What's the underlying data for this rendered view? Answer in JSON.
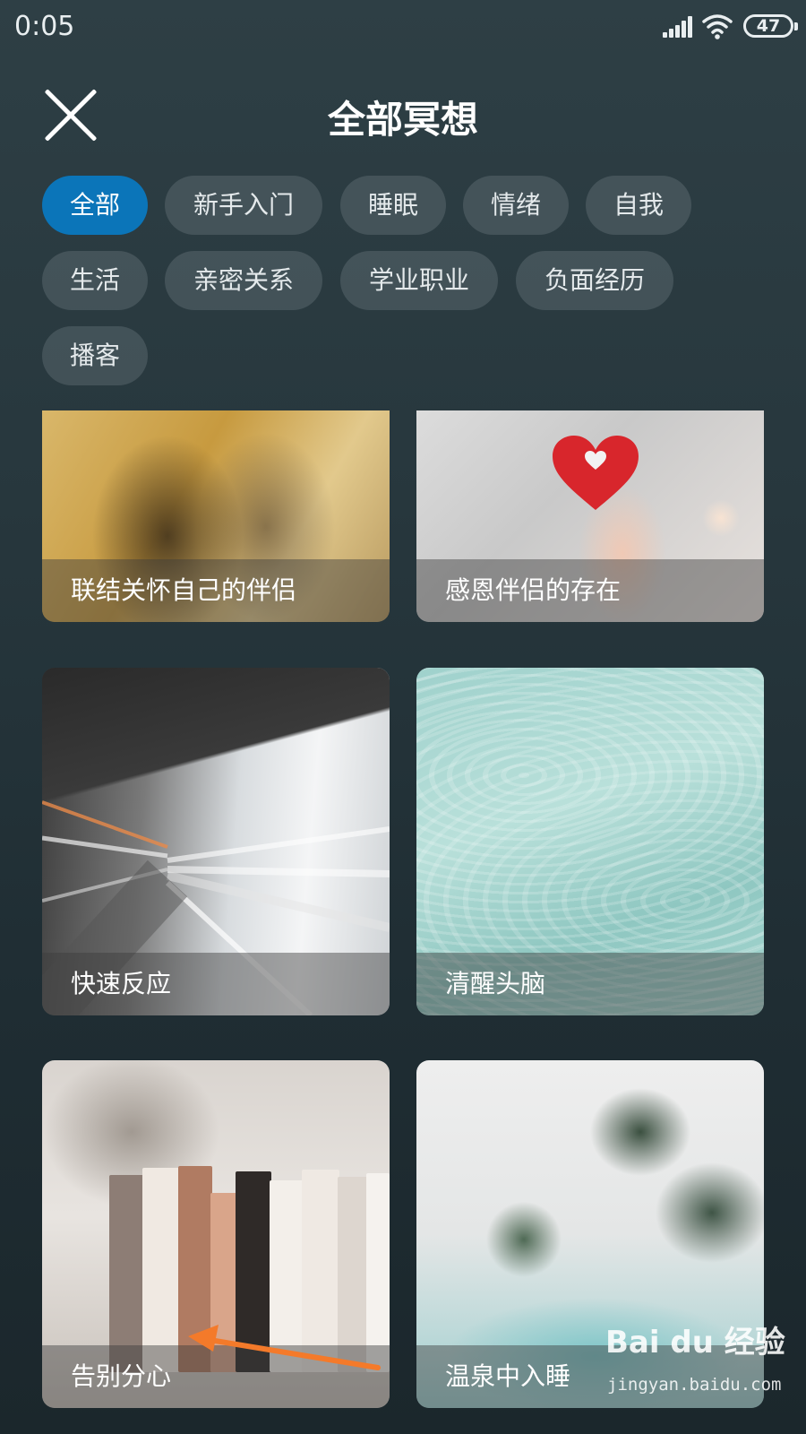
{
  "status_bar": {
    "time": "0:05",
    "battery": "47",
    "icons": [
      "signal-icon",
      "wifi-icon",
      "battery-icon"
    ]
  },
  "header": {
    "title": "全部冥想",
    "close_icon": "close-icon"
  },
  "filters": {
    "active_index": 0,
    "items": [
      "全部",
      "新手入门",
      "睡眠",
      "情绪",
      "自我",
      "生活",
      "亲密关系",
      "学业职业",
      "负面经历",
      "播客"
    ]
  },
  "cards": [
    {
      "title": "联结关怀自己的伴侣"
    },
    {
      "title": "感恩伴侣的存在"
    },
    {
      "title": "快速反应"
    },
    {
      "title": "清醒头脑"
    },
    {
      "title": "告别分心"
    },
    {
      "title": "温泉中入睡"
    }
  ],
  "watermark": {
    "brand": "Bai du 经验",
    "url": "jingyan.baidu.com"
  },
  "colors": {
    "accent": "#0b75b9",
    "chip_bg": "#4a5a60",
    "annotation_arrow": "#f47a2a"
  }
}
